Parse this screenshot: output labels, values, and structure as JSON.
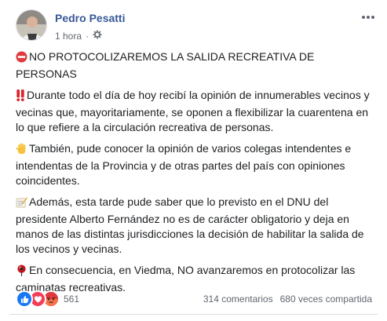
{
  "post": {
    "author": "Pedro Pesatti",
    "time": "1 hora",
    "separator": "·",
    "audience_icon": "globe-gear-icon",
    "more_icon": "more-dots-icon",
    "paragraphs": [
      {
        "emoji": "no-entry-icon",
        "text": "NO PROTOCOLIZAREMOS LA SALIDA RECREATIVA DE PERSONAS"
      },
      {
        "emoji": "double-exclamation-icon",
        "text": "Durante todo el día de hoy recibí la opinión de innumerables vecinos y vecinas que, mayoritariamente, se oponen a flexibilizar la cuarentena en lo que refiere a la circulación recreativa de personas."
      },
      {
        "emoji": "raised-hand-icon",
        "text": "También, pude conocer la opinión de varios colegas intendentes e intendentas de la Provincia y de otras partes del país con opiniones coincidentes."
      },
      {
        "emoji": "memo-icon",
        "text": "Además, esta tarde pude saber que lo previsto en el DNU del presidente Alberto Fernández no es de carácter obligatorio y deja en manos de las distintas jurisdicciones la decisión de habilitar la salida de los vecinos y vecinas."
      },
      {
        "emoji": "round-pushpin-icon",
        "text": "En consecuencia, en Viedma, NO avanzaremos en protocolizar las caminatas recreativas."
      }
    ]
  },
  "footer": {
    "reactions": [
      "like-icon",
      "love-icon",
      "angry-icon"
    ],
    "reaction_count": "561",
    "comments": "314 comentarios",
    "shares": "680 veces compartida"
  },
  "colors": {
    "author": "#385898",
    "like": "#1877f2",
    "love": "#f33e58",
    "angry": "#f7714c"
  }
}
